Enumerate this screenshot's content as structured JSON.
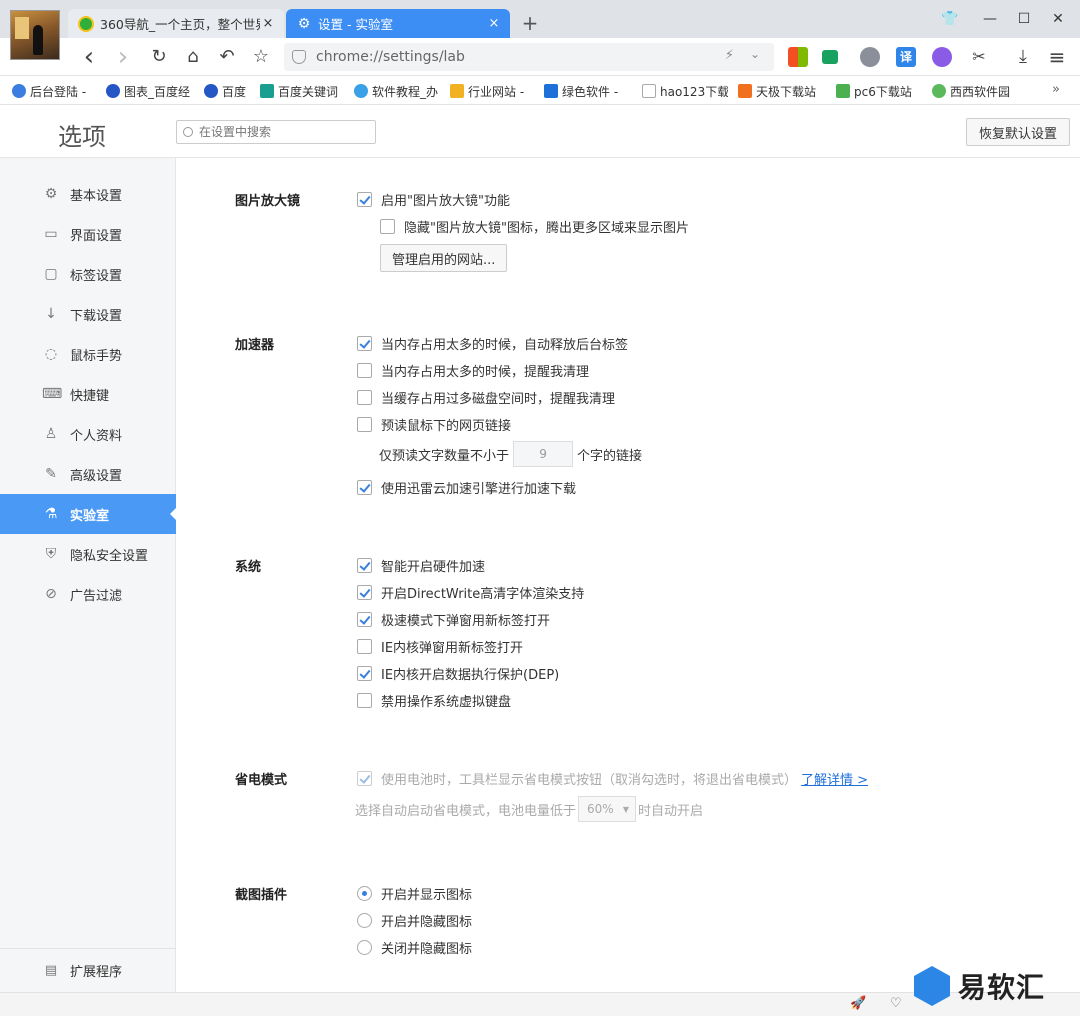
{
  "tabs": [
    {
      "label": "360导航_一个主页，整个世界",
      "close": "×"
    },
    {
      "label": "设置 - 实验室",
      "close": "×"
    }
  ],
  "newtab": "+",
  "window": {
    "skin": "👕",
    "minimize": "—",
    "maximize": "☐",
    "close": "✕"
  },
  "toolbar": {
    "back": "‹",
    "forward": "›",
    "reload": "↻",
    "home": "⌂",
    "undo": "↶",
    "star": "☆",
    "address": "chrome://settings/lab",
    "bolt": "⚡",
    "dropdown": "⌄",
    "ext_translate": "译",
    "scissors": "✂",
    "download": "⤓",
    "menu": "≡"
  },
  "bookmarks": [
    {
      "label": "后台登陆 -",
      "color": "#3b7de0"
    },
    {
      "label": "图表_百度经",
      "color": "#2456c5"
    },
    {
      "label": "百度",
      "color": "#2456c5"
    },
    {
      "label": "百度关键词",
      "color": "#1a9e8f"
    },
    {
      "label": "软件教程_办",
      "color": "#3aa0e8"
    },
    {
      "label": "行业网站 -",
      "color": "#f1b120"
    },
    {
      "label": "绿色软件 -",
      "color": "#1f6fd8"
    },
    {
      "label": "hao123下载",
      "color": "#dddddd"
    },
    {
      "label": "天极下载站",
      "color": "#f07020"
    },
    {
      "label": "pc6下载站",
      "color": "#4caf50"
    },
    {
      "label": "西西软件园",
      "color": "#5cb85c"
    }
  ],
  "bookmarks_more": "»",
  "settings": {
    "title": "选项",
    "search_placeholder": "在设置中搜索",
    "restore_label": "恢复默认设置"
  },
  "sidebar": {
    "items": [
      {
        "label": "基本设置",
        "icon": "⚙"
      },
      {
        "label": "界面设置",
        "icon": "▭"
      },
      {
        "label": "标签设置",
        "icon": "▢"
      },
      {
        "label": "下载设置",
        "icon": "↓"
      },
      {
        "label": "鼠标手势",
        "icon": "◌"
      },
      {
        "label": "快捷键",
        "icon": "⌨"
      },
      {
        "label": "个人资料",
        "icon": "♙"
      },
      {
        "label": "高级设置",
        "icon": "✎"
      },
      {
        "label": "实验室",
        "icon": "⚗"
      },
      {
        "label": "隐私安全设置",
        "icon": "⛨"
      },
      {
        "label": "广告过滤",
        "icon": "⊘"
      }
    ],
    "extensions": {
      "label": "扩展程序",
      "icon": "▤"
    }
  },
  "sections": {
    "magnifier": {
      "title": "图片放大镜",
      "enable": "启用\"图片放大镜\"功能",
      "hide_icon": "隐藏\"图片放大镜\"图标，腾出更多区域来显示图片",
      "manage_button": "管理启用的网站..."
    },
    "accelerator": {
      "title": "加速器",
      "items": [
        "当内存占用太多的时候，自动释放后台标签",
        "当内存占用太多的时候，提醒我清理",
        "当缓存占用过多磁盘空间时，提醒我清理",
        "预读鼠标下的网页链接"
      ],
      "prefetch_prefix": "仅预读文字数量不小于",
      "prefetch_value": "9",
      "prefetch_suffix": "个字的链接",
      "thunder": "使用迅雷云加速引擎进行加速下载"
    },
    "system": {
      "title": "系统",
      "items": [
        "智能开启硬件加速",
        "开启DirectWrite高清字体渲染支持",
        "极速模式下弹窗用新标签打开",
        "IE内核弹窗用新标签打开",
        "IE内核开启数据执行保护(DEP)",
        "禁用操作系统虚拟键盘"
      ]
    },
    "power": {
      "title": "省电模式",
      "battery": "使用电池时，工具栏显示省电模式按钮（取消勾选时，将退出省电模式）",
      "learn_more": "了解详情 >",
      "auto_prefix": "选择自动启动省电模式，电池电量低于",
      "auto_value": "60%",
      "auto_suffix": "时自动开启"
    },
    "screenshot": {
      "title": "截图插件",
      "options": [
        "开启并显示图标",
        "开启并隐藏图标",
        "关闭并隐藏图标"
      ]
    }
  },
  "statusbar": {
    "rocket": "🚀",
    "heart": "♡"
  },
  "watermark": {
    "text": "易软汇"
  }
}
